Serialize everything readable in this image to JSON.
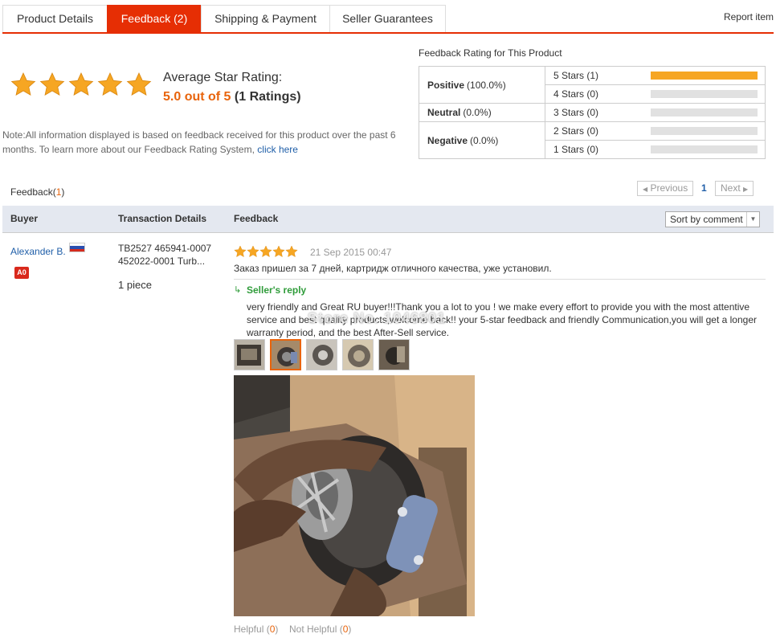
{
  "tabs": [
    {
      "label": "Product Details"
    },
    {
      "label": "Feedback (2)"
    },
    {
      "label": "Shipping & Payment"
    },
    {
      "label": "Seller Guarantees"
    }
  ],
  "report_label": "Report item",
  "summary": {
    "stars": 5,
    "avg_label": "Average Star Rating:",
    "avg_score": "5.0 out of 5",
    "avg_count": "(1 Ratings)",
    "note": "Note:All information displayed is based on feedback received for this product over the past 6 months. To learn more about our Feedback Rating System,",
    "note_link": "click here"
  },
  "rating_table": {
    "title": "Feedback Rating for This Product",
    "categories": [
      {
        "name": "Positive",
        "pct": "(100.0%)"
      },
      {
        "name": "Neutral",
        "pct": "(0.0%)"
      },
      {
        "name": "Negative",
        "pct": "(0.0%)"
      }
    ],
    "rows": [
      {
        "label": "5 Stars (1)",
        "fill": 1.0
      },
      {
        "label": "4 Stars (0)",
        "fill": 0
      },
      {
        "label": "3 Stars (0)",
        "fill": 0
      },
      {
        "label": "2 Stars (0)",
        "fill": 0
      },
      {
        "label": "1 Stars (0)",
        "fill": 0
      }
    ],
    "fill_color": "#f6a623",
    "empty_color": "#e1e1e1"
  },
  "feedback_count": {
    "label": "Feedback(",
    "num": "1",
    "close": ")"
  },
  "pagination": {
    "prev": "Previous",
    "current": "1",
    "next": "Next"
  },
  "columns": {
    "buyer": "Buyer",
    "transaction": "Transaction Details",
    "feedback": "Feedback"
  },
  "sort": {
    "label": "Sort by comment"
  },
  "entry": {
    "buyer": "Alexander B.",
    "badge": "A0",
    "transaction": "TB2527 465941-0007 452022-0001 Turb...",
    "quantity": "1 piece",
    "stars": 5,
    "date": "21 Sep 2015 00:47",
    "text": "Заказ пришел за 7 дней, картридж отличного качества, уже установил.",
    "reply_title": "Seller's reply",
    "reply_text": "very friendly and Great RU buyer!!!Thank you a lot to you ! we make every effort to provide you with the most attentive service and best quality products,welcome back!! your 5-star feedback and friendly Communication,you will get a longer warranty period, and the best After-Sell service.",
    "watermark": "Store No. 1046801",
    "helpful_label": "Helpful (",
    "helpful_count": "0",
    "not_helpful_label": "Not Helpful (",
    "not_helpful_count": "0",
    "close_paren": ")"
  },
  "colors": {
    "accent": "#e62e04",
    "orange": "#e8640c",
    "link": "#1f5ea8",
    "green": "#2f9c3a",
    "star": "#f6a623"
  }
}
